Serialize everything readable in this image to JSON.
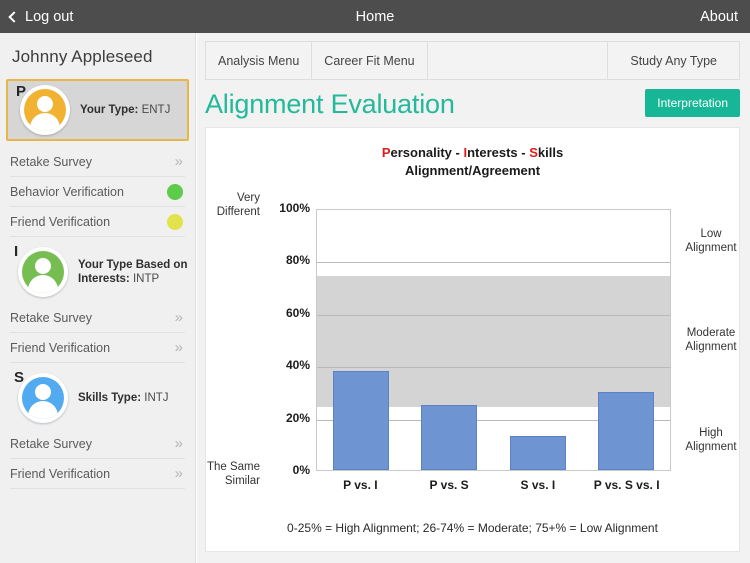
{
  "topbar": {
    "logout_label": "Log out",
    "title": "Home",
    "about_label": "About"
  },
  "sidebar": {
    "user_name": "Johnny Appleseed",
    "blocks": [
      {
        "letter": "P",
        "avatar_color": "#f2b231",
        "label_prefix": "Your Type:",
        "label_value": "ENTJ",
        "highlighted": true,
        "rows": [
          {
            "label": "Retake Survey",
            "indicator": "arrow"
          },
          {
            "label": "Behavior Verification",
            "indicator": "dot",
            "dot_color": "#5ccc4a"
          },
          {
            "label": "Friend Verification",
            "indicator": "dot",
            "dot_color": "#e2e24a"
          }
        ]
      },
      {
        "letter": "I",
        "avatar_color": "#76bd52",
        "label_prefix": "Your Type Based on Interests:",
        "label_value": "INTP",
        "highlighted": false,
        "rows": [
          {
            "label": "Retake Survey",
            "indicator": "arrow"
          },
          {
            "label": "Friend Verification",
            "indicator": "arrow"
          }
        ]
      },
      {
        "letter": "S",
        "avatar_color": "#52aaf0",
        "label_prefix": "Skills Type:",
        "label_value": "INTJ",
        "highlighted": false,
        "rows": [
          {
            "label": "Retake Survey",
            "indicator": "arrow"
          },
          {
            "label": "Friend Verification",
            "indicator": "arrow"
          }
        ]
      }
    ]
  },
  "main": {
    "tabs": [
      {
        "label": "Analysis Menu"
      },
      {
        "label": "Career Fit Menu"
      },
      {
        "label": ""
      },
      {
        "label": "Study Any Type"
      }
    ],
    "page_title": "Alignment Evaluation",
    "interpretation_label": "Interpretation",
    "accent_color": "#16b696"
  },
  "chart_data": {
    "type": "bar",
    "title_line1_parts": [
      {
        "text": "P",
        "highlight": true
      },
      {
        "text": "ersonality - ",
        "highlight": false
      },
      {
        "text": "I",
        "highlight": true
      },
      {
        "text": "nterests - ",
        "highlight": false
      },
      {
        "text": "S",
        "highlight": true
      },
      {
        "text": "kills",
        "highlight": false
      }
    ],
    "title_line2": "Alignment/Agreement",
    "categories": [
      "P vs. I",
      "P vs. S",
      "S vs. I",
      "P vs. S vs. I"
    ],
    "values": [
      38,
      25,
      13,
      30
    ],
    "ylim": [
      0,
      100
    ],
    "yticks": [
      0,
      20,
      40,
      60,
      80,
      100
    ],
    "ytick_labels": [
      "0%",
      "20%",
      "40%",
      "60%",
      "80%",
      "100%"
    ],
    "ylabel_top": "Very Different",
    "ylabel_bottom": "The Same Similar",
    "bar_color": "#6e94d1",
    "band_color": "#d4d4d4",
    "band_range": [
      25,
      75
    ],
    "right_labels": [
      {
        "text": "Low Alignment",
        "at_pct": 88
      },
      {
        "text": "Moderate Alignment",
        "at_pct": 50
      },
      {
        "text": "High Alignment",
        "at_pct": 12
      }
    ],
    "footnote": "0-25% = High Alignment; 26-74% = Moderate; 75+% = Low Alignment",
    "grid": true,
    "legend": "none"
  }
}
